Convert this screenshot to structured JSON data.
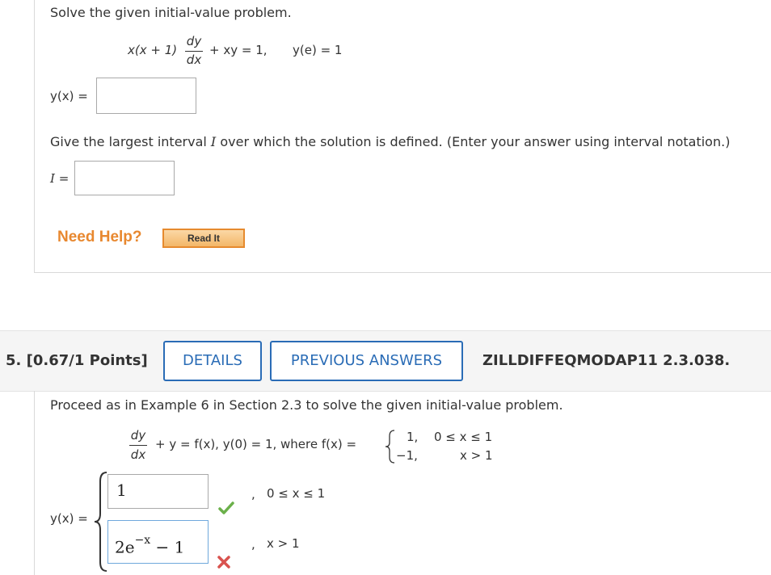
{
  "q4": {
    "prompt": "Solve the given initial-value problem.",
    "eq_left": "x(x + 1)",
    "frac_num": "dy",
    "frac_den": "dx",
    "eq_right": "+ xy = 1,",
    "initial": "y(e) = 1",
    "y_label": "y(x) =",
    "interval_prompt_a": "Give the largest interval ",
    "interval_var": "I",
    "interval_prompt_b": " over which the solution is defined. (Enter your answer using interval notation.)",
    "i_label_var": "I",
    "i_label_eq": "=",
    "need_help": "Need Help?",
    "read_it": "Read It"
  },
  "q5": {
    "points": "5.  [0.67/1 Points]",
    "details_button": "DETAILS",
    "previous_answers_button": "PREVIOUS ANSWERS",
    "problem_code": "ZILLDIFFEQMODAP11 2.3.038.",
    "prompt": "Proceed as in Example 6 in Section 2.3 to solve the given initial-value problem.",
    "frac_num": "dy",
    "frac_den": "dx",
    "eq_text": "+ y = f(x), y(0) = 1, where f(x) =",
    "case1_value": "1,",
    "case1_cond": "0 ≤ x ≤ 1",
    "case2_value": "−1,",
    "case2_cond": "x > 1",
    "y_label": "y(x) =",
    "answer1": "1",
    "answer1_comma": ",",
    "answer1_cond": "0 ≤ x ≤ 1",
    "answer2_base": "2e",
    "answer2_exp": "−x",
    "answer2_tail": " − 1",
    "answer2_comma": ",",
    "answer2_cond": "x > 1",
    "answer1_status": "correct",
    "answer2_status": "incorrect"
  },
  "colors": {
    "link_blue": "#2a6cb6",
    "help_orange": "#e8882f",
    "check_green": "#6bb04a",
    "cross_red": "#d9534f"
  }
}
